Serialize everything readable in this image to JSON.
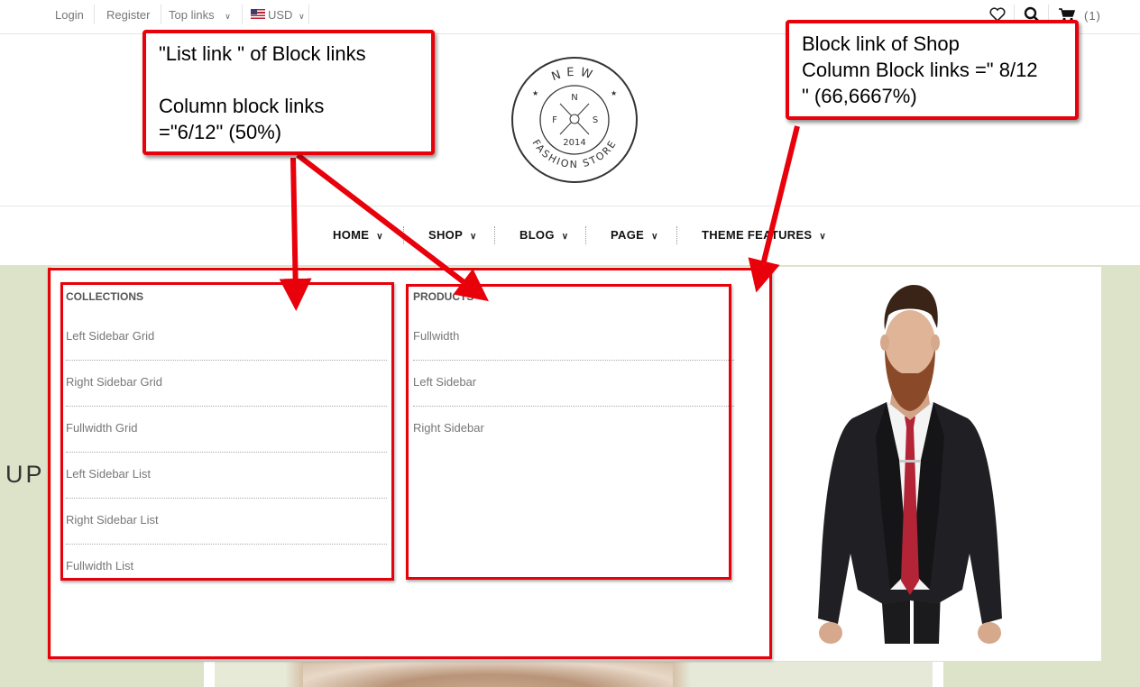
{
  "topbar": {
    "login": "Login",
    "register": "Register",
    "top_links": "Top links",
    "currency": "USD",
    "cart_count": "(1)"
  },
  "nav": {
    "items": [
      {
        "label": "HOME"
      },
      {
        "label": "SHOP"
      },
      {
        "label": "BLOG"
      },
      {
        "label": "PAGE"
      },
      {
        "label": "THEME FEATURES"
      }
    ]
  },
  "logo": {
    "top_text": "NEW",
    "bottom_text": "FASHION STORE",
    "year": "2014",
    "n": "N",
    "s": "S",
    "f": "F"
  },
  "hero": {
    "word": "UP"
  },
  "mega_menu": {
    "collections": {
      "title": "COLLECTIONS",
      "links": [
        "Left Sidebar Grid",
        "Right Sidebar Grid",
        "Fullwidth Grid",
        "Left Sidebar List",
        "Right Sidebar List",
        "Fullwidth List"
      ]
    },
    "products": {
      "title": "PRODUCTS",
      "links": [
        "Fullwidth",
        "Left Sidebar",
        "Right Sidebar"
      ]
    }
  },
  "annotations": {
    "left_callout": {
      "line1": "\"List link \" of Block links",
      "line2": "Column block links",
      "line3": "=\"6/12\" (50%)"
    },
    "right_callout": {
      "line1": "Block link of Shop",
      "line2": "Column Block links =\" 8/12",
      "line3": "\" (66,6667%)"
    }
  },
  "colors": {
    "annotation_red": "#e8000b",
    "hero_background": "#dde3c9"
  },
  "icons": [
    "heart-icon",
    "search-icon",
    "cart-icon",
    "chevron-down-icon",
    "us-flag-icon"
  ]
}
